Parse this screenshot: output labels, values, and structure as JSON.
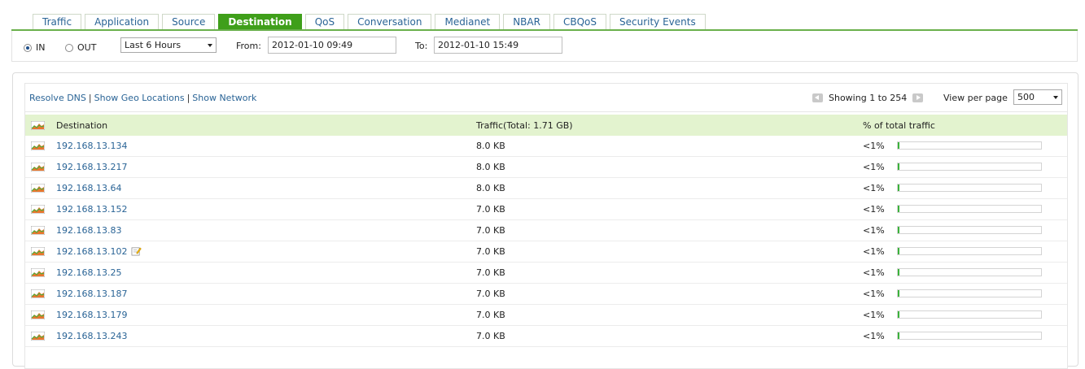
{
  "tabs": [
    {
      "label": "Traffic",
      "active": false
    },
    {
      "label": "Application",
      "active": false
    },
    {
      "label": "Source",
      "active": false
    },
    {
      "label": "Destination",
      "active": true
    },
    {
      "label": "QoS",
      "active": false
    },
    {
      "label": "Conversation",
      "active": false
    },
    {
      "label": "Medianet",
      "active": false
    },
    {
      "label": "NBAR",
      "active": false
    },
    {
      "label": "CBQoS",
      "active": false
    },
    {
      "label": "Security Events",
      "active": false
    }
  ],
  "filter": {
    "in_label": "IN",
    "out_label": "OUT",
    "selected_direction": "IN",
    "period": "Last 6 Hours",
    "from_label": "From:",
    "from_value": "2012-01-10 09:49",
    "to_label": "To:",
    "to_value": "2012-01-10 15:49"
  },
  "toolbar": {
    "resolve_dns": "Resolve DNS",
    "show_geo": "Show Geo Locations",
    "show_network": "Show Network",
    "separator": "|",
    "showing": "Showing 1 to 254",
    "view_per_page_label": "View per page",
    "view_per_page_value": "500"
  },
  "table": {
    "headers": {
      "destination": "Destination",
      "traffic": "Traffic(Total: 1.71 GB)",
      "percent": "% of total traffic"
    },
    "rows": [
      {
        "destination": "192.168.13.134",
        "traffic": "8.0 KB",
        "percent": "<1%",
        "share": 0.01,
        "note": false
      },
      {
        "destination": "192.168.13.217",
        "traffic": "8.0 KB",
        "percent": "<1%",
        "share": 0.01,
        "note": false
      },
      {
        "destination": "192.168.13.64",
        "traffic": "8.0 KB",
        "percent": "<1%",
        "share": 0.01,
        "note": false
      },
      {
        "destination": "192.168.13.152",
        "traffic": "7.0 KB",
        "percent": "<1%",
        "share": 0.01,
        "note": false
      },
      {
        "destination": "192.168.13.83",
        "traffic": "7.0 KB",
        "percent": "<1%",
        "share": 0.01,
        "note": false
      },
      {
        "destination": "192.168.13.102",
        "traffic": "7.0 KB",
        "percent": "<1%",
        "share": 0.01,
        "note": true
      },
      {
        "destination": "192.168.13.25",
        "traffic": "7.0 KB",
        "percent": "<1%",
        "share": 0.01,
        "note": false
      },
      {
        "destination": "192.168.13.187",
        "traffic": "7.0 KB",
        "percent": "<1%",
        "share": 0.01,
        "note": false
      },
      {
        "destination": "192.168.13.179",
        "traffic": "7.0 KB",
        "percent": "<1%",
        "share": 0.01,
        "note": false
      },
      {
        "destination": "192.168.13.243",
        "traffic": "7.0 KB",
        "percent": "<1%",
        "share": 0.01,
        "note": false
      }
    ]
  },
  "colors": {
    "accent": "#3f9f1a",
    "link": "#2a6496",
    "header_bg": "#e3f3cf",
    "bar_fill": "#3bb23b"
  },
  "icons": {
    "row_graph": "graph-icon",
    "note": "note-edit-icon",
    "pager_prev": "prev-page-icon",
    "pager_next": "next-page-icon"
  }
}
